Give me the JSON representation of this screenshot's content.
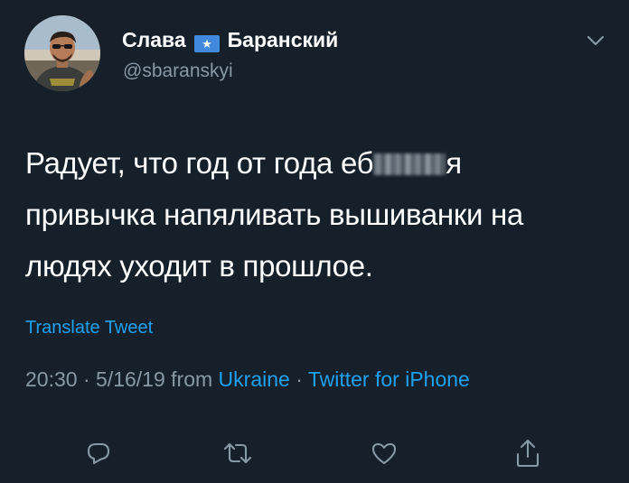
{
  "author": {
    "name_first": "Слава",
    "name_last": "Баранский",
    "flag_icon": "somalia-flag-icon",
    "handle": "@sbaranskyi"
  },
  "tweet": {
    "line1_before": "Радует, что год от года еб",
    "line1_after": "я",
    "line2": "привычка напяливать вышиванки на",
    "line3": "людях уходит в прошлое."
  },
  "translate_label": "Translate Tweet",
  "meta": {
    "time": "20:30",
    "separator": "·",
    "date": "5/16/19",
    "from_label": "from",
    "location": "Ukraine",
    "client": "Twitter for iPhone"
  },
  "actions": {
    "reply_icon": "reply-icon",
    "retweet_icon": "retweet-icon",
    "like_icon": "heart-icon",
    "share_icon": "share-icon"
  },
  "colors": {
    "background": "#15202b",
    "text": "#ffffff",
    "secondary": "#8899a6",
    "accent": "#1da1f2",
    "flag_blue": "#4189dd"
  }
}
